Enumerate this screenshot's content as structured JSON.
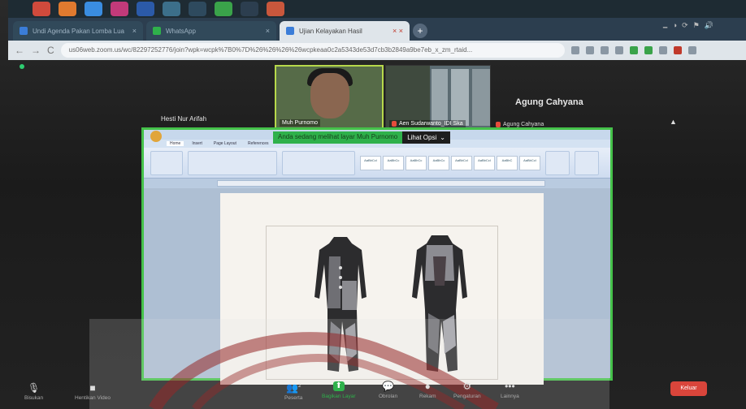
{
  "browser": {
    "tabs": [
      {
        "label": "Undi Agenda Pakan Lomba Lua",
        "active": false
      },
      {
        "label": "WhatsApp",
        "active": false
      },
      {
        "label": "Ujian Kelayakan Hasil",
        "active": true
      }
    ],
    "new_tab": "+",
    "url": "us06web.zoom.us/wc/82297252776/join?wpk=wcpk%7B0%7D%26%26%26%26wcpkeaa0c2a5343de53d7cb3b2849a9be7eb_x_zm_rtaid...",
    "nav": {
      "back": "←",
      "forward": "→",
      "reload": "C"
    },
    "window_controls": [
      "🗕",
      "◑",
      "⟳",
      "⚑",
      "🔊"
    ]
  },
  "meeting": {
    "participants": [
      {
        "name": "Muh Purnomo",
        "role": "speaker"
      },
      {
        "name": "Aen Sudarwanto_IDI Ska",
        "muted": true
      }
    ],
    "floating_name": "Hesti Nur Arifah",
    "active_name_large": "Agung Cahyana",
    "active_name_small": "Agung Cahyana",
    "share_status": "Anda sedang melihat layar Muh Purnomo",
    "view_options": "Lihat Opsi"
  },
  "word": {
    "tabs": [
      "Home",
      "Insert",
      "Page Layout",
      "References"
    ],
    "styles": [
      "AaBbCcI",
      "AaBbCc",
      "AaBbCc",
      "AaBbCc",
      "AaBbCcI",
      "AaBbCcI",
      "AaBbC",
      "AaBbCcI"
    ]
  },
  "toolbar": {
    "mute": "Bisukan",
    "stop_video": "Hentikan Video",
    "participants": "Peserta",
    "participant_count": "2",
    "share_screen": "Bagikan Layar",
    "chat": "Obrolan",
    "record": "Rekam",
    "settings": "Pengaturan",
    "more": "Lainnya",
    "exit": "Keluar"
  },
  "colors": {
    "accent_green": "#2fb14b",
    "exit_red": "#d9453b"
  }
}
